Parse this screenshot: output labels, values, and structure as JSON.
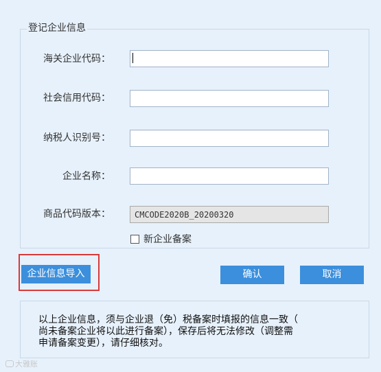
{
  "form": {
    "legend": "登记企业信息",
    "fields": [
      {
        "label": "海关企业代码：",
        "value": ""
      },
      {
        "label": "社会信用代码：",
        "value": ""
      },
      {
        "label": "纳税人识别号：",
        "value": ""
      },
      {
        "label": "企业名称：",
        "value": ""
      },
      {
        "label": "商品代码版本：",
        "value": "CMCODE2020B_20200320"
      }
    ],
    "new_enterprise_checkbox": {
      "label": "新企业备案",
      "checked": false
    }
  },
  "buttons": {
    "import": "企业信息导入",
    "confirm": "确认",
    "cancel": "取消"
  },
  "note": {
    "lines": [
      "以上企业信息，须与企业退（免）税备案时填报的信息一致（",
      "尚未备案企业将以此进行备案），保存后将无法修改（调整需",
      "申请备案变更），请仔细核对。"
    ]
  },
  "watermark": "大雅账"
}
